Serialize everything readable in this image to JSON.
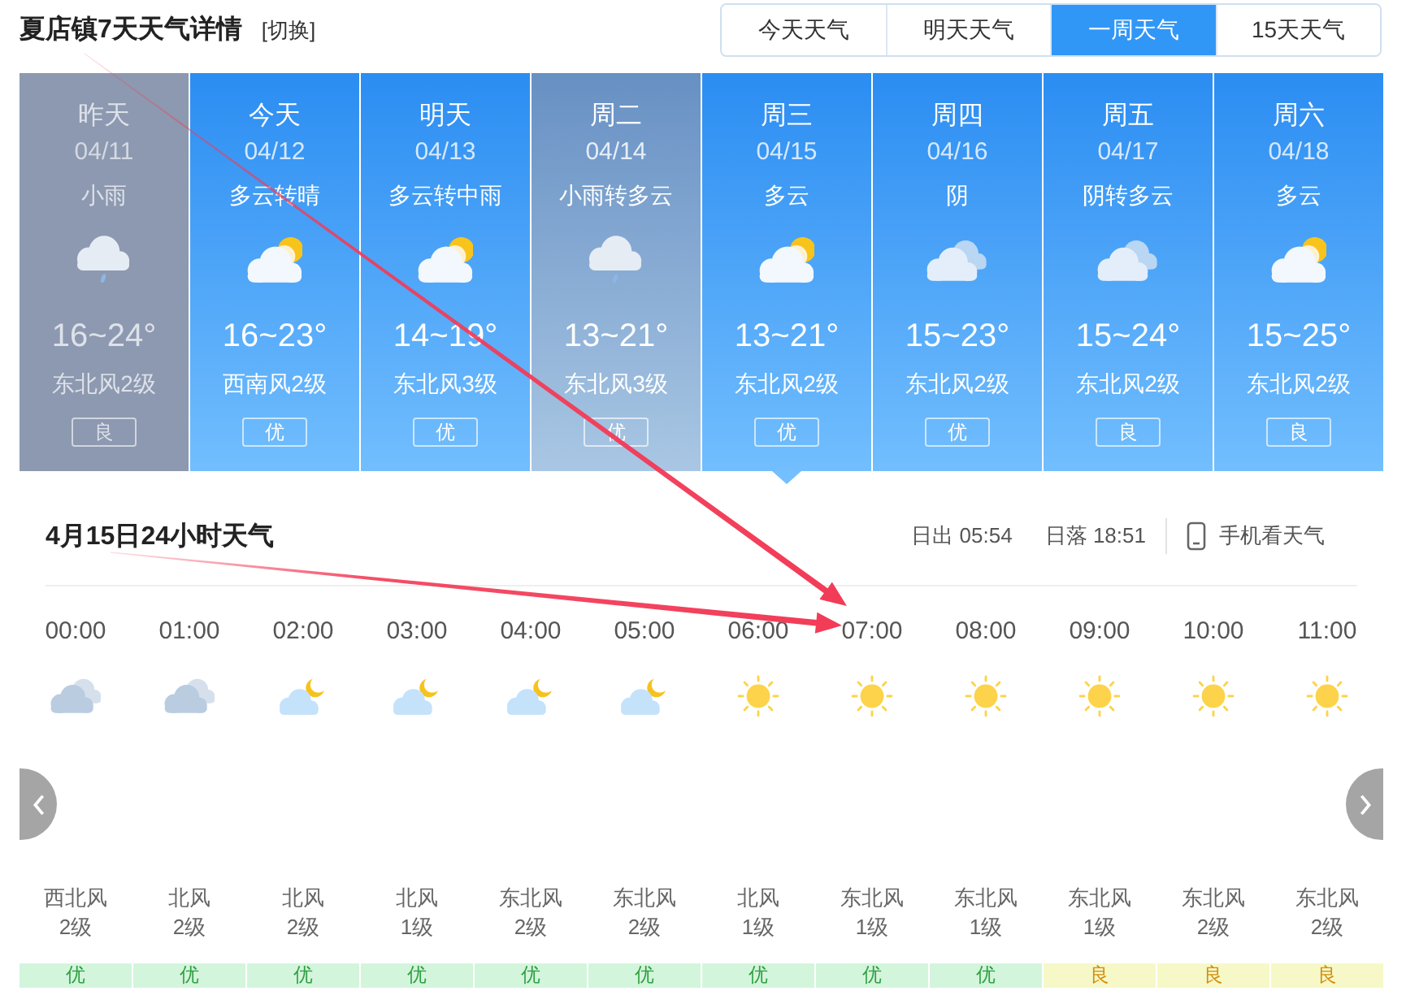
{
  "header": {
    "title": "夏店镇7天天气详情",
    "switch_link": "[切换]"
  },
  "tabs": [
    {
      "label": "今天天气",
      "selected": false
    },
    {
      "label": "明天天气",
      "selected": false
    },
    {
      "label": "一周天气",
      "selected": true
    },
    {
      "label": "15天天气",
      "selected": false
    }
  ],
  "days": [
    {
      "day": "昨天",
      "date": "04/11",
      "condition": "小雨",
      "kind": "rain",
      "temp": "16~24°",
      "wind": "东北风2级",
      "aqi": "良",
      "past": true,
      "hovered": false,
      "selected": false
    },
    {
      "day": "今天",
      "date": "04/12",
      "condition": "多云转晴",
      "kind": "partly_cloudy",
      "temp": "16~23°",
      "wind": "西南风2级",
      "aqi": "优",
      "past": false,
      "hovered": false,
      "selected": false
    },
    {
      "day": "明天",
      "date": "04/13",
      "condition": "多云转中雨",
      "kind": "partly_cloudy",
      "temp": "14~19°",
      "wind": "东北风3级",
      "aqi": "优",
      "past": false,
      "hovered": false,
      "selected": false
    },
    {
      "day": "周二",
      "date": "04/14",
      "condition": "小雨转多云",
      "kind": "rain",
      "temp": "13~21°",
      "wind": "东北风3级",
      "aqi": "优",
      "past": false,
      "hovered": true,
      "selected": false
    },
    {
      "day": "周三",
      "date": "04/15",
      "condition": "多云",
      "kind": "partly_cloudy",
      "temp": "13~21°",
      "wind": "东北风2级",
      "aqi": "优",
      "past": false,
      "hovered": false,
      "selected": true
    },
    {
      "day": "周四",
      "date": "04/16",
      "condition": "阴",
      "kind": "overcast",
      "temp": "15~23°",
      "wind": "东北风2级",
      "aqi": "优",
      "past": false,
      "hovered": false,
      "selected": false
    },
    {
      "day": "周五",
      "date": "04/17",
      "condition": "阴转多云",
      "kind": "overcast",
      "temp": "15~24°",
      "wind": "东北风2级",
      "aqi": "良",
      "past": false,
      "hovered": false,
      "selected": false
    },
    {
      "day": "周六",
      "date": "04/18",
      "condition": "多云",
      "kind": "partly_cloudy",
      "temp": "15~25°",
      "wind": "东北风2级",
      "aqi": "良",
      "past": false,
      "hovered": false,
      "selected": false
    }
  ],
  "hourly": {
    "title": "4月15日24小时天气",
    "sunrise": "日出 05:54",
    "sunset": "日落 18:51",
    "mobile_link": "手机看天气",
    "hours": [
      {
        "time": "00:00",
        "kind": "overcast",
        "wind_direction": "西北风",
        "wind_level": "2级",
        "aqi": {
          "label": "优",
          "kind": "excellent"
        }
      },
      {
        "time": "01:00",
        "kind": "overcast",
        "wind_direction": "北风",
        "wind_level": "2级",
        "aqi": {
          "label": "优",
          "kind": "excellent"
        }
      },
      {
        "time": "02:00",
        "kind": "night_partly_cloudy",
        "wind_direction": "北风",
        "wind_level": "2级",
        "aqi": {
          "label": "优",
          "kind": "excellent"
        }
      },
      {
        "time": "03:00",
        "kind": "night_partly_cloudy",
        "wind_direction": "北风",
        "wind_level": "1级",
        "aqi": {
          "label": "优",
          "kind": "excellent"
        }
      },
      {
        "time": "04:00",
        "kind": "night_partly_cloudy",
        "wind_direction": "东北风",
        "wind_level": "2级",
        "aqi": {
          "label": "优",
          "kind": "excellent"
        }
      },
      {
        "time": "05:00",
        "kind": "night_partly_cloudy",
        "wind_direction": "东北风",
        "wind_level": "2级",
        "aqi": {
          "label": "优",
          "kind": "excellent"
        }
      },
      {
        "time": "06:00",
        "kind": "sunny",
        "wind_direction": "北风",
        "wind_level": "1级",
        "aqi": {
          "label": "优",
          "kind": "excellent"
        }
      },
      {
        "time": "07:00",
        "kind": "sunny",
        "wind_direction": "东北风",
        "wind_level": "1级",
        "aqi": {
          "label": "优",
          "kind": "excellent"
        }
      },
      {
        "time": "08:00",
        "kind": "sunny",
        "wind_direction": "东北风",
        "wind_level": "1级",
        "aqi": {
          "label": "优",
          "kind": "excellent"
        }
      },
      {
        "time": "09:00",
        "kind": "sunny",
        "wind_direction": "东北风",
        "wind_level": "1级",
        "aqi": {
          "label": "良",
          "kind": "good"
        }
      },
      {
        "time": "10:00",
        "kind": "sunny",
        "wind_direction": "东北风",
        "wind_level": "2级",
        "aqi": {
          "label": "良",
          "kind": "good"
        }
      },
      {
        "time": "11:00",
        "kind": "sunny",
        "wind_direction": "东北风",
        "wind_level": "2级",
        "aqi": {
          "label": "良",
          "kind": "good"
        }
      }
    ]
  }
}
